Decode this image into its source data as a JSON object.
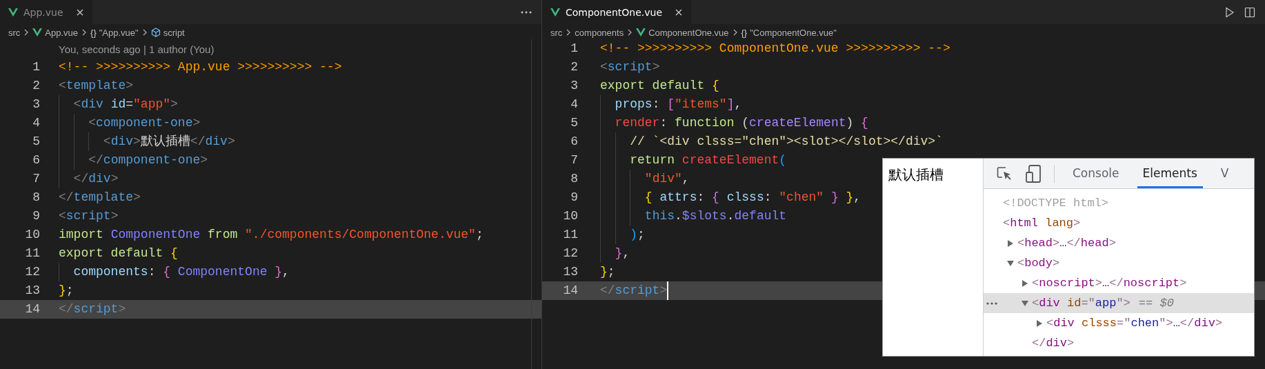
{
  "editors": [
    {
      "focused": false,
      "tabs": [
        {
          "label": "App.vue",
          "selected": true
        }
      ],
      "actions": [
        {
          "kind": "more"
        }
      ],
      "breadcrumbs": [
        {
          "kind": "folder",
          "text": "src"
        },
        {
          "kind": "file",
          "text": "App.vue"
        },
        {
          "kind": "symbol",
          "glyph": "{}",
          "text": "\"App.vue\""
        },
        {
          "kind": "module",
          "text": "script"
        }
      ],
      "codelens": "You, seconds ago | 1 author (You)",
      "lines": [
        {
          "number": "1",
          "current": false,
          "tokens": [
            {
              "kind": "comment",
              "text": "<!-- >>>>>>>>>> App.vue >>>>>>>>>> -->"
            }
          ]
        },
        {
          "number": "2",
          "current": false,
          "tokens": [
            {
              "kind": "punct",
              "text": "<"
            },
            {
              "kind": "tag",
              "text": "template"
            },
            {
              "kind": "punct",
              "text": ">"
            }
          ]
        },
        {
          "number": "3",
          "current": false,
          "tokens": [
            {
              "kind": "punct",
              "text": "  <"
            },
            {
              "kind": "tag",
              "text": "div"
            },
            {
              "kind": "attr",
              "text": " id"
            },
            {
              "kind": "plain",
              "text": "="
            },
            {
              "kind": "string",
              "text": "\"app\""
            },
            {
              "kind": "punct",
              "text": ">"
            }
          ]
        },
        {
          "number": "4",
          "current": false,
          "tokens": [
            {
              "kind": "punct",
              "text": "    <"
            },
            {
              "kind": "tag",
              "text": "component-one"
            },
            {
              "kind": "punct",
              "text": ">"
            }
          ]
        },
        {
          "number": "5",
          "current": false,
          "tokens": [
            {
              "kind": "punct",
              "text": "      <"
            },
            {
              "kind": "tag",
              "text": "div"
            },
            {
              "kind": "punct",
              "text": ">"
            },
            {
              "kind": "plain",
              "text": "默认插槽"
            },
            {
              "kind": "punct",
              "text": "</"
            },
            {
              "kind": "tag",
              "text": "div"
            },
            {
              "kind": "punct",
              "text": ">"
            }
          ]
        },
        {
          "number": "6",
          "current": false,
          "tokens": [
            {
              "kind": "punct",
              "text": "    </"
            },
            {
              "kind": "tag",
              "text": "component-one"
            },
            {
              "kind": "punct",
              "text": ">"
            }
          ]
        },
        {
          "number": "7",
          "current": false,
          "tokens": [
            {
              "kind": "punct",
              "text": "  </"
            },
            {
              "kind": "tag",
              "text": "div"
            },
            {
              "kind": "punct",
              "text": ">"
            }
          ]
        },
        {
          "number": "8",
          "current": false,
          "tokens": [
            {
              "kind": "punct",
              "text": "</"
            },
            {
              "kind": "tag",
              "text": "template"
            },
            {
              "kind": "punct",
              "text": ">"
            }
          ]
        },
        {
          "number": "9",
          "current": false,
          "tokens": [
            {
              "kind": "punct",
              "text": "<"
            },
            {
              "kind": "tag",
              "text": "script"
            },
            {
              "kind": "punct",
              "text": ">"
            }
          ]
        },
        {
          "number": "10",
          "current": false,
          "tokens": [
            {
              "kind": "keyword",
              "text": "import "
            },
            {
              "kind": "class",
              "text": "ComponentOne"
            },
            {
              "kind": "keyword",
              "text": " from "
            },
            {
              "kind": "string",
              "text": "\"./components/ComponentOne.vue\""
            },
            {
              "kind": "plain",
              "text": ";"
            }
          ]
        },
        {
          "number": "11",
          "current": false,
          "tokens": [
            {
              "kind": "keyword",
              "text": "export default "
            },
            {
              "kind": "brace1",
              "text": "{"
            }
          ]
        },
        {
          "number": "12",
          "current": false,
          "tokens": [
            {
              "kind": "prop",
              "text": "  components"
            },
            {
              "kind": "plain",
              "text": ": "
            },
            {
              "kind": "brace2",
              "text": "{"
            },
            {
              "kind": "class",
              "text": " ComponentOne "
            },
            {
              "kind": "brace2",
              "text": "}"
            },
            {
              "kind": "plain",
              "text": ","
            }
          ]
        },
        {
          "number": "13",
          "current": false,
          "tokens": [
            {
              "kind": "brace1",
              "text": "}"
            },
            {
              "kind": "plain",
              "text": ";"
            }
          ]
        },
        {
          "number": "14",
          "current": true,
          "tokens": [
            {
              "kind": "punct",
              "text": "</"
            },
            {
              "kind": "tag",
              "text": "script"
            },
            {
              "kind": "punct",
              "text": ">"
            }
          ]
        }
      ]
    },
    {
      "focused": true,
      "tabs": [
        {
          "label": "ComponentOne.vue",
          "selected": true
        }
      ],
      "actions": [
        {
          "kind": "run"
        },
        {
          "kind": "split"
        }
      ],
      "breadcrumbs": [
        {
          "kind": "folder",
          "text": "src"
        },
        {
          "kind": "folder",
          "text": "components"
        },
        {
          "kind": "file",
          "text": "ComponentOne.vue"
        },
        {
          "kind": "symbol",
          "glyph": "{}",
          "text": "\"ComponentOne.vue\""
        }
      ],
      "lines": [
        {
          "number": "1",
          "current": false,
          "tokens": [
            {
              "kind": "comment",
              "text": "<!-- >>>>>>>>>> ComponentOne.vue >>>>>>>>>> -->"
            }
          ]
        },
        {
          "number": "2",
          "current": false,
          "tokens": [
            {
              "kind": "punct",
              "text": "<"
            },
            {
              "kind": "tag",
              "text": "script"
            },
            {
              "kind": "punct",
              "text": ">"
            }
          ]
        },
        {
          "number": "3",
          "current": false,
          "tokens": [
            {
              "kind": "keyword",
              "text": "export default "
            },
            {
              "kind": "brace1",
              "text": "{"
            }
          ]
        },
        {
          "number": "4",
          "current": false,
          "tokens": [
            {
              "kind": "prop",
              "text": "  props"
            },
            {
              "kind": "plain",
              "text": ": "
            },
            {
              "kind": "brace2",
              "text": "["
            },
            {
              "kind": "string",
              "text": "\"items\""
            },
            {
              "kind": "brace2",
              "text": "]"
            },
            {
              "kind": "plain",
              "text": ","
            }
          ]
        },
        {
          "number": "5",
          "current": false,
          "tokens": [
            {
              "kind": "red",
              "text": "  render"
            },
            {
              "kind": "plain",
              "text": ": "
            },
            {
              "kind": "keyword",
              "text": "function "
            },
            {
              "kind": "plain",
              "text": "("
            },
            {
              "kind": "param",
              "text": "createElement"
            },
            {
              "kind": "plain",
              "text": ") "
            },
            {
              "kind": "brace2",
              "text": "{"
            }
          ]
        },
        {
          "number": "6",
          "current": false,
          "tokens": [
            {
              "kind": "note",
              "text": "    // `<div clsss=\"chen\"><slot></slot></div>`"
            }
          ]
        },
        {
          "number": "7",
          "current": false,
          "tokens": [
            {
              "kind": "keyword",
              "text": "    return "
            },
            {
              "kind": "red",
              "text": "createElement"
            },
            {
              "kind": "brace3",
              "text": "("
            }
          ]
        },
        {
          "number": "8",
          "current": false,
          "tokens": [
            {
              "kind": "string",
              "text": "      \"div\""
            },
            {
              "kind": "plain",
              "text": ","
            }
          ]
        },
        {
          "number": "9",
          "current": false,
          "tokens": [
            {
              "kind": "brace1",
              "text": "      {"
            },
            {
              "kind": "prop",
              "text": " attrs"
            },
            {
              "kind": "plain",
              "text": ": "
            },
            {
              "kind": "brace2",
              "text": "{"
            },
            {
              "kind": "prop",
              "text": " clsss"
            },
            {
              "kind": "plain",
              "text": ": "
            },
            {
              "kind": "string",
              "text": "\"chen\""
            },
            {
              "kind": "brace2",
              "text": " }"
            },
            {
              "kind": "brace1",
              "text": " }"
            },
            {
              "kind": "plain",
              "text": ","
            }
          ]
        },
        {
          "number": "10",
          "current": false,
          "tokens": [
            {
              "kind": "tag",
              "text": "      this"
            },
            {
              "kind": "plain",
              "text": "."
            },
            {
              "kind": "class",
              "text": "$slots"
            },
            {
              "kind": "plain",
              "text": "."
            },
            {
              "kind": "class",
              "text": "default"
            }
          ]
        },
        {
          "number": "11",
          "current": false,
          "tokens": [
            {
              "kind": "brace3",
              "text": "    )"
            },
            {
              "kind": "plain",
              "text": ";"
            }
          ]
        },
        {
          "number": "12",
          "current": false,
          "tokens": [
            {
              "kind": "brace2",
              "text": "  }"
            },
            {
              "kind": "plain",
              "text": ","
            }
          ]
        },
        {
          "number": "13",
          "current": false,
          "tokens": [
            {
              "kind": "brace1",
              "text": "}"
            },
            {
              "kind": "plain",
              "text": ";"
            }
          ]
        },
        {
          "number": "14",
          "current": true,
          "tokens": [
            {
              "kind": "punct",
              "text": "</"
            },
            {
              "kind": "tag",
              "text": "script"
            },
            {
              "kind": "punct",
              "text": ">"
            }
          ]
        }
      ]
    }
  ],
  "devtools": {
    "preview_text": "默认插槽",
    "tabs": [
      {
        "label": "Console",
        "selected": false
      },
      {
        "label": "Elements",
        "selected": true
      },
      {
        "label": "V",
        "selected": false
      }
    ],
    "tree": [
      {
        "selected": false,
        "tokens": [
          {
            "kind": "doctype",
            "text": "<!DOCTYPE html>"
          }
        ]
      },
      {
        "selected": false,
        "tokens": [
          {
            "kind": "punct",
            "text": "<"
          },
          {
            "kind": "tag",
            "text": "html"
          },
          {
            "kind": "attr",
            "text": " lang"
          },
          {
            "kind": "punct",
            "text": ">"
          }
        ],
        "children": [
          {
            "selected": false,
            "expanded": false,
            "tokens": [
              {
                "kind": "punct",
                "text": "<"
              },
              {
                "kind": "tag",
                "text": "head"
              },
              {
                "kind": "punct",
                "text": ">"
              },
              {
                "kind": "ellipsis",
                "text": "…"
              },
              {
                "kind": "punct",
                "text": "</"
              },
              {
                "kind": "tag",
                "text": "head"
              },
              {
                "kind": "punct",
                "text": ">"
              }
            ]
          },
          {
            "selected": false,
            "expanded": true,
            "tokens": [
              {
                "kind": "punct",
                "text": "<"
              },
              {
                "kind": "tag",
                "text": "body"
              },
              {
                "kind": "punct",
                "text": ">"
              }
            ],
            "children": [
              {
                "selected": false,
                "expanded": false,
                "tokens": [
                  {
                    "kind": "punct",
                    "text": "<"
                  },
                  {
                    "kind": "tag",
                    "text": "noscript"
                  },
                  {
                    "kind": "punct",
                    "text": ">"
                  },
                  {
                    "kind": "ellipsis",
                    "text": "…"
                  },
                  {
                    "kind": "punct",
                    "text": "</"
                  },
                  {
                    "kind": "tag",
                    "text": "noscript"
                  },
                  {
                    "kind": "punct",
                    "text": ">"
                  }
                ]
              },
              {
                "selected": true,
                "expanded": true,
                "console_ref": "== $0",
                "tokens": [
                  {
                    "kind": "punct",
                    "text": "<"
                  },
                  {
                    "kind": "tag",
                    "text": "div"
                  },
                  {
                    "kind": "attr",
                    "text": " id"
                  },
                  {
                    "kind": "punct",
                    "text": "=\""
                  },
                  {
                    "kind": "value",
                    "text": "app"
                  },
                  {
                    "kind": "punct",
                    "text": "\">"
                  }
                ],
                "children": [
                  {
                    "selected": false,
                    "expanded": false,
                    "tokens": [
                      {
                        "kind": "punct",
                        "text": "<"
                      },
                      {
                        "kind": "tag",
                        "text": "div"
                      },
                      {
                        "kind": "attr",
                        "text": " clsss"
                      },
                      {
                        "kind": "punct",
                        "text": "=\""
                      },
                      {
                        "kind": "value",
                        "text": "chen"
                      },
                      {
                        "kind": "punct",
                        "text": "\">"
                      },
                      {
                        "kind": "ellipsis",
                        "text": "…"
                      },
                      {
                        "kind": "punct",
                        "text": "</"
                      },
                      {
                        "kind": "tag",
                        "text": "div"
                      },
                      {
                        "kind": "punct",
                        "text": ">"
                      }
                    ]
                  }
                ],
                "closing": [
                  {
                    "kind": "punct",
                    "text": "</"
                  },
                  {
                    "kind": "tag",
                    "text": "div"
                  },
                  {
                    "kind": "punct",
                    "text": ">"
                  }
                ]
              }
            ]
          }
        ]
      }
    ]
  }
}
